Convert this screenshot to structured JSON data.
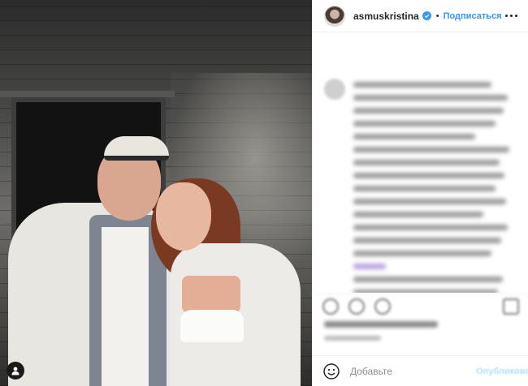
{
  "post": {
    "username": "asmuskristina",
    "follow_label": "Подписаться",
    "more_icon": "more-horizontal-icon",
    "verified_icon": "verified-badge-icon"
  },
  "photo": {
    "user_tag_icon": "user-tag-icon"
  },
  "comment_box": {
    "emoji_icon": "emoji-icon",
    "placeholder": "Добавьте комментарий...",
    "placeholder_visible": "Добавьте",
    "publish_label": "Опубликовать"
  },
  "colors": {
    "accent": "#3897f0",
    "publish_disabled": "#b2dffc",
    "text": "#262626",
    "muted": "#8e8e8e"
  }
}
